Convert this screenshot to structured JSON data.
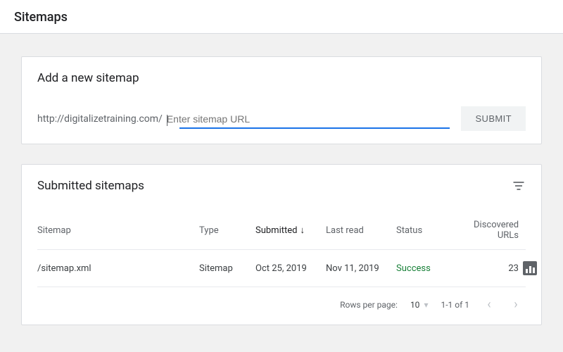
{
  "header": {
    "title": "Sitemaps"
  },
  "addCard": {
    "title": "Add a new sitemap",
    "baseUrl": "http://digitalizetraining.com/",
    "placeholder": "Enter sitemap URL",
    "submit": "SUBMIT"
  },
  "listCard": {
    "title": "Submitted sitemaps",
    "columns": {
      "sitemap": "Sitemap",
      "type": "Type",
      "submitted": "Submitted",
      "lastRead": "Last read",
      "status": "Status",
      "discovered": "Discovered URLs"
    },
    "rows": [
      {
        "sitemap": "/sitemap.xml",
        "type": "Sitemap",
        "submitted": "Oct 25, 2019",
        "lastRead": "Nov 11, 2019",
        "status": "Success",
        "discovered": "23"
      }
    ],
    "pager": {
      "rowsLabel": "Rows per page:",
      "rowsValue": "10",
      "range": "1-1 of 1"
    }
  }
}
